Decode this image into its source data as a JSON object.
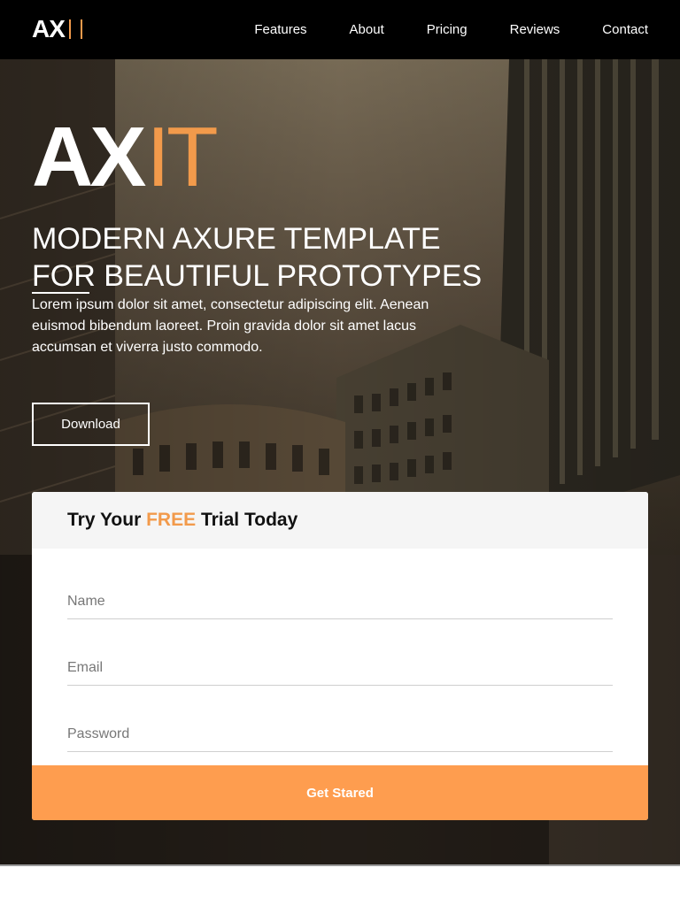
{
  "nav": {
    "logo": "AX",
    "items": [
      "Features",
      "About",
      "Pricing",
      "Reviews",
      "Contact"
    ]
  },
  "hero": {
    "brand_bold": "AX",
    "brand_light": "IT",
    "headline": [
      "MODERN AXURE TEMPLATE",
      "FOR BEAUTIFUL PROTOTYPES"
    ],
    "lede": "Lorem ipsum dolor sit amet, consectetur adipiscing elit. Aenean euismod bibendum laoreet. Proin gravida dolor sit amet lacus accumsan et viverra justo commodo.",
    "download_label": "Download"
  },
  "trial": {
    "title_start": "Try Your ",
    "title_accent": "FREE",
    "title_end": " Trial Today",
    "name_placeholder": "Name",
    "email_placeholder": "Email",
    "password_placeholder": "Password",
    "submit_label": "Get Stared"
  },
  "colors": {
    "accent": "#f29a4b",
    "button": "#fe9d4f",
    "nav_bg": "#000000"
  }
}
